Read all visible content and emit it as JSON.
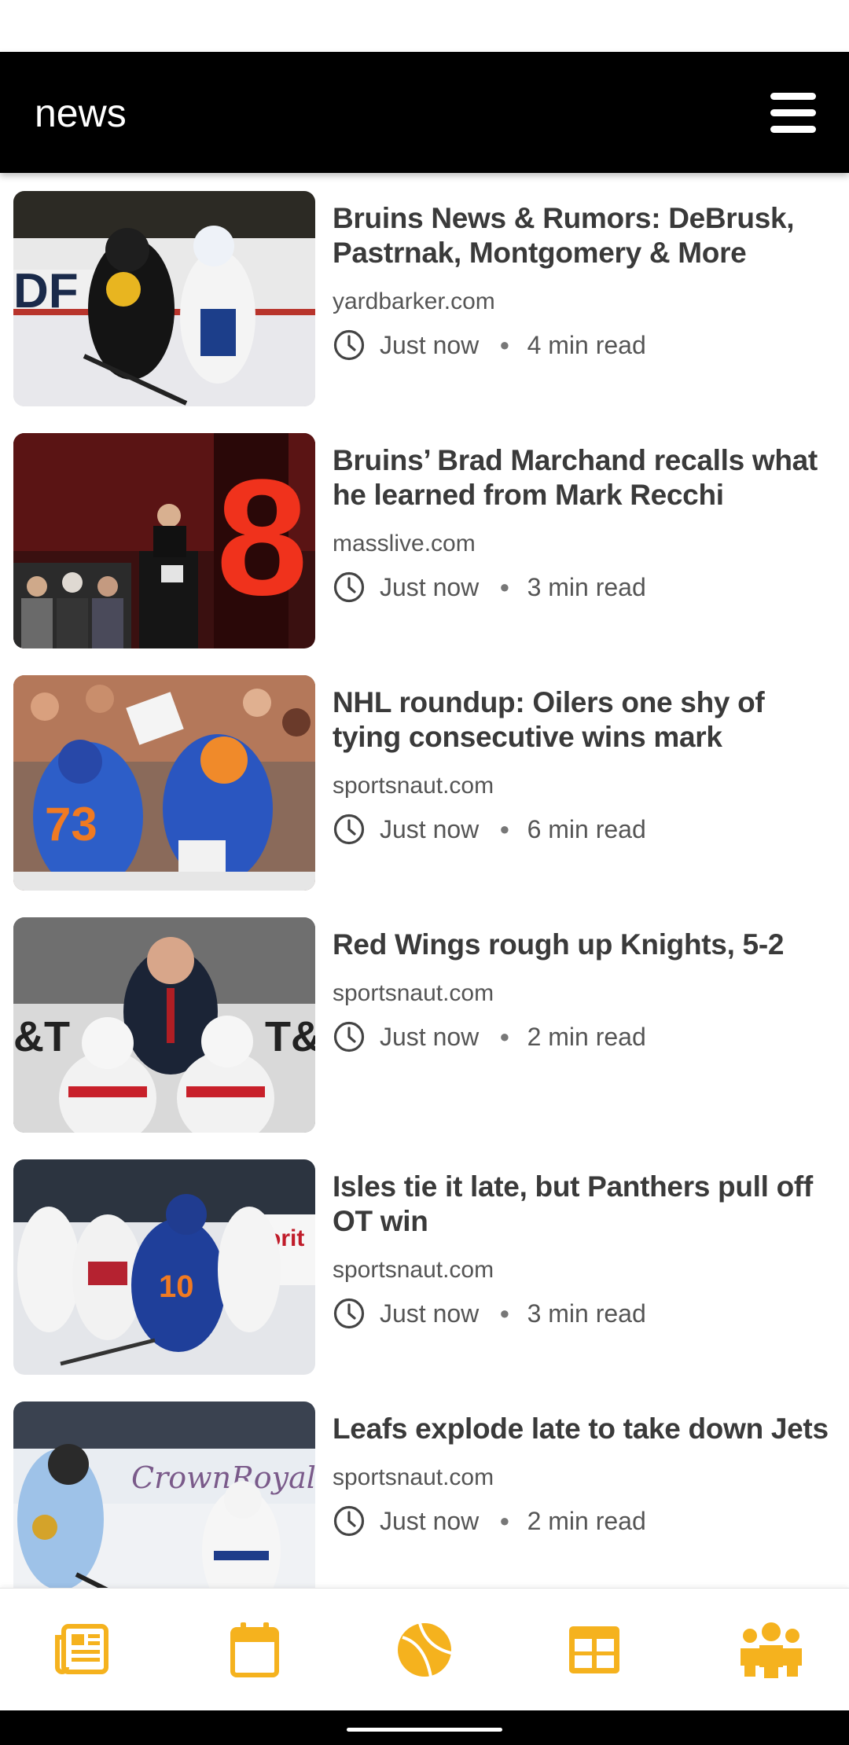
{
  "header": {
    "title": "news"
  },
  "articles": [
    {
      "headline": "Bruins News & Rumors: DeBrusk, Pastrnak, Montgomery & More",
      "source": "yardbarker.com",
      "time": "Just now",
      "read_time": "4 min read"
    },
    {
      "headline": "Bruins’ Brad Marchand recalls what he learned from Mark Recchi",
      "source": "masslive.com",
      "time": "Just now",
      "read_time": "3 min read"
    },
    {
      "headline": "NHL roundup: Oilers one shy of tying consecutive wins mark",
      "source": "sportsnaut.com",
      "time": "Just now",
      "read_time": "6 min read"
    },
    {
      "headline": "Red Wings rough up Knights, 5-2",
      "source": "sportsnaut.com",
      "time": "Just now",
      "read_time": "2 min read"
    },
    {
      "headline": "Isles tie it late, but Panthers pull off OT win",
      "source": "sportsnaut.com",
      "time": "Just now",
      "read_time": "3 min read"
    },
    {
      "headline": "Leafs explode late to take down Jets",
      "source": "sportsnaut.com",
      "time": "Just now",
      "read_time": "2 min read"
    }
  ],
  "bottom_nav": {
    "items": [
      {
        "icon": "news-icon",
        "active": true
      },
      {
        "icon": "calendar-icon",
        "active": false
      },
      {
        "icon": "ball-icon",
        "active": false
      },
      {
        "icon": "grid-icon",
        "active": false
      },
      {
        "icon": "team-icon",
        "active": false
      }
    ]
  },
  "colors": {
    "header_bg": "#000000",
    "accent": "#F5B21E",
    "headline": "#3a3a3a",
    "secondary_text": "#555555"
  }
}
